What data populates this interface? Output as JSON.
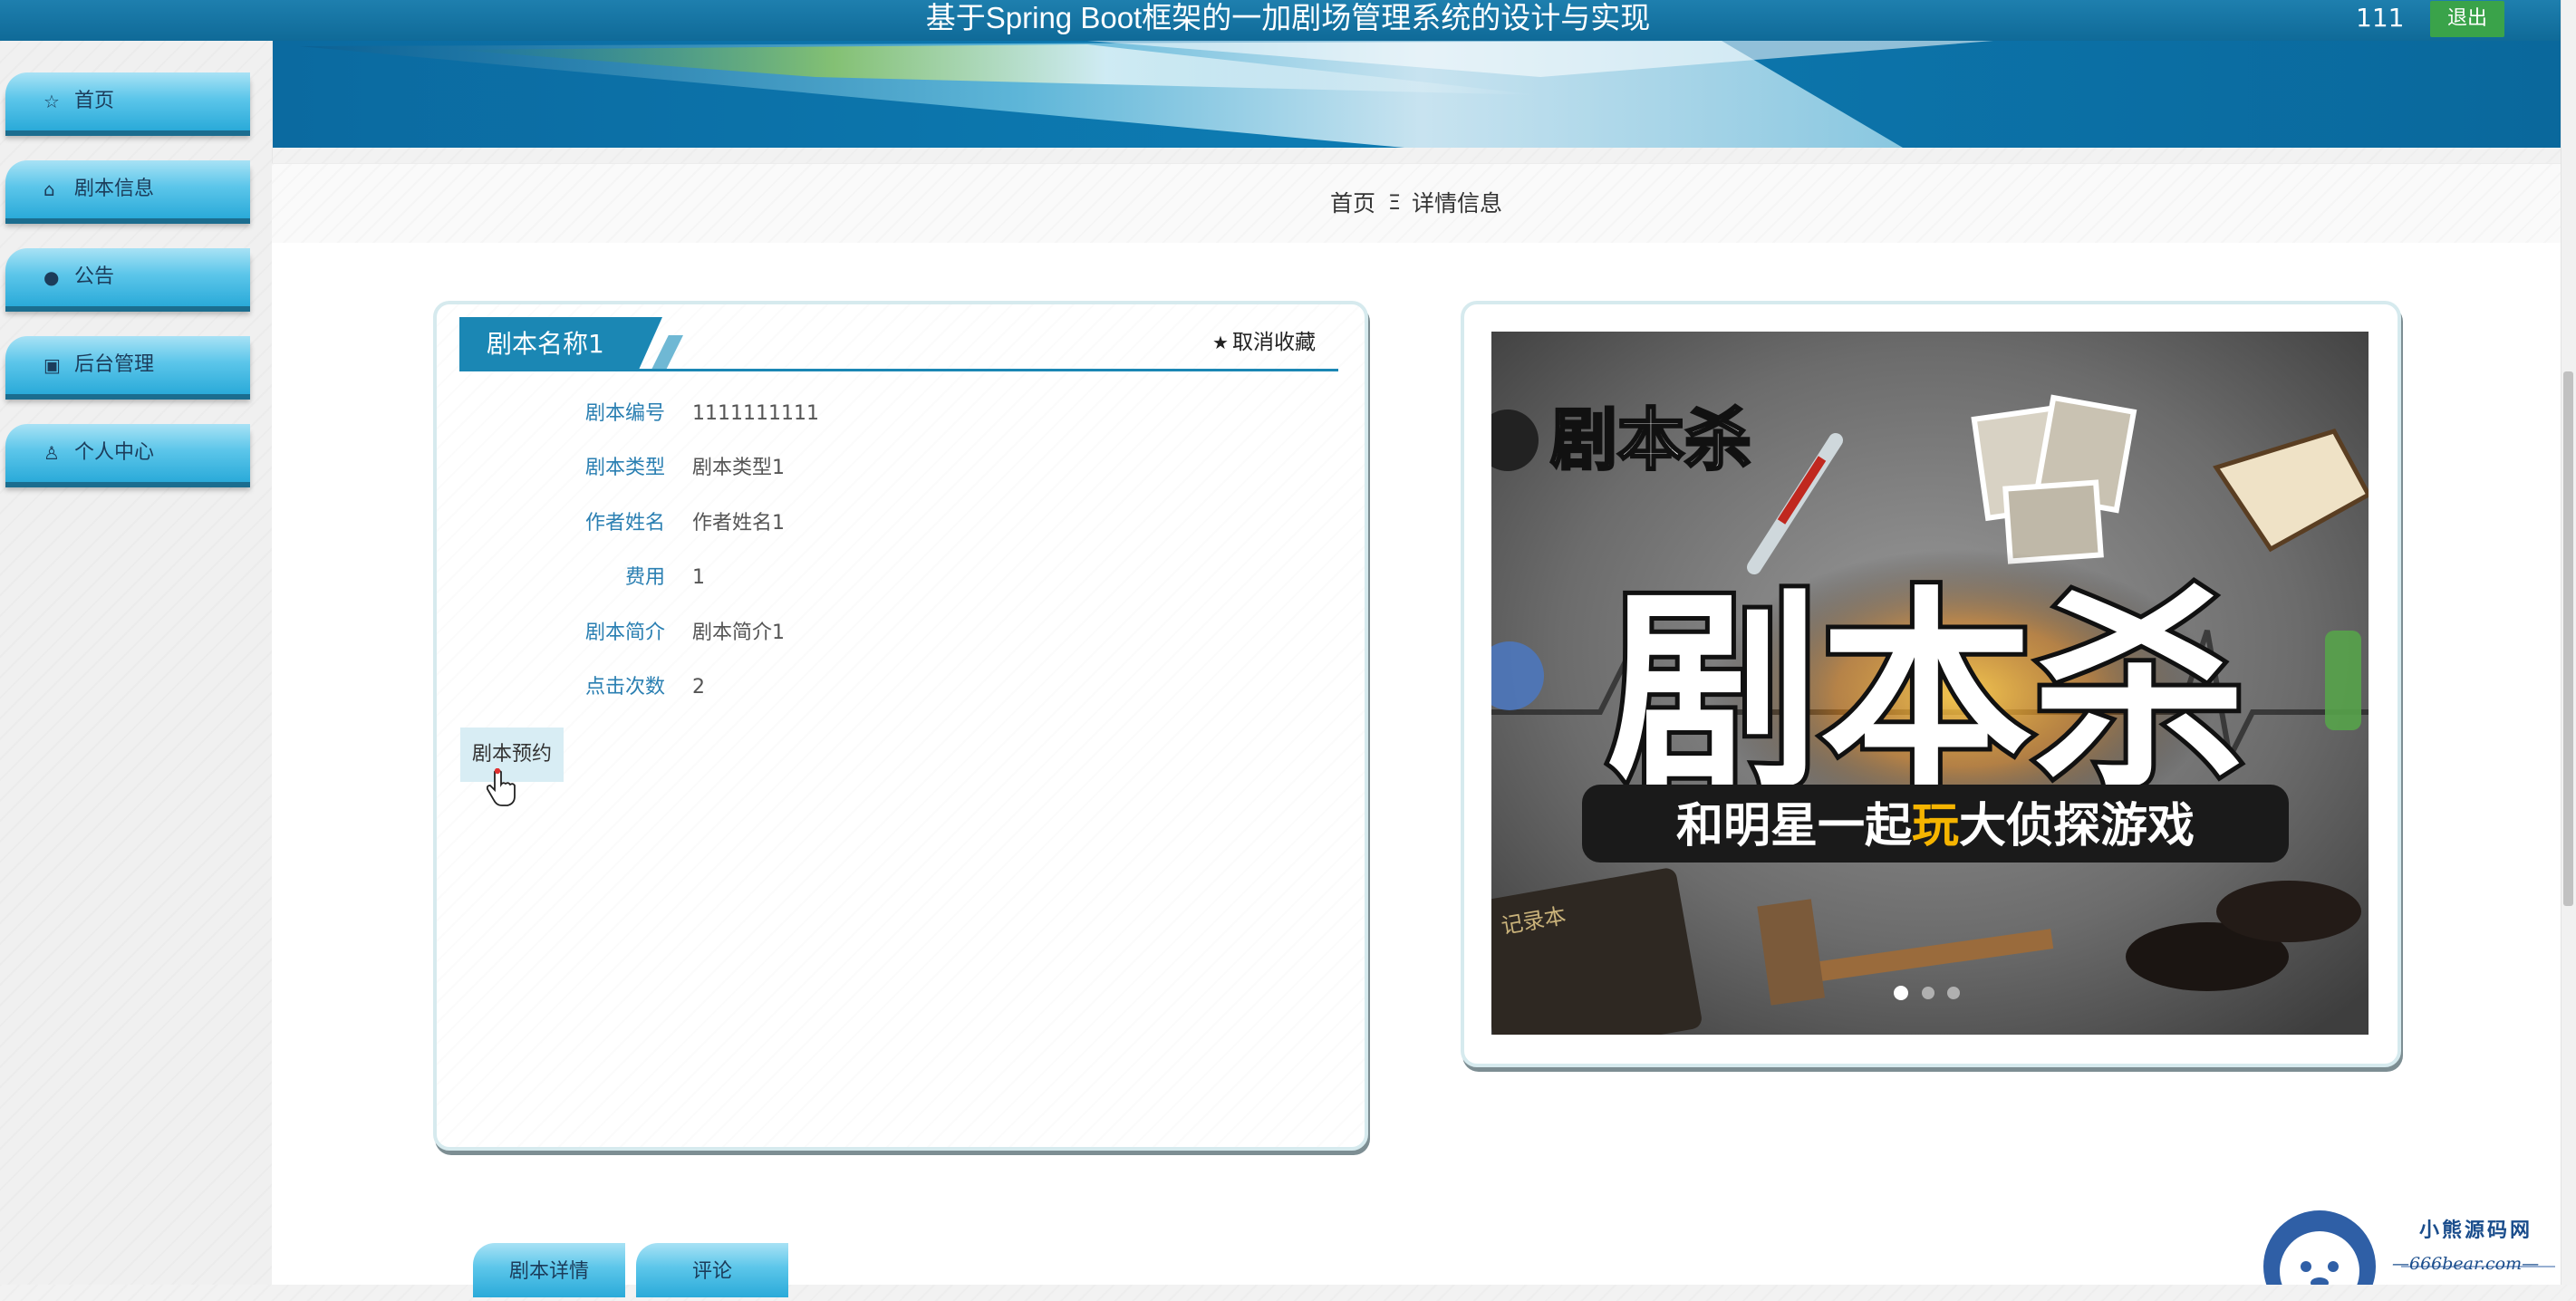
{
  "header": {
    "title": "基于Spring Boot框架的一加剧场管理系统的设计与实现",
    "username": "111",
    "logout_label": "退出"
  },
  "sidebar": {
    "items": [
      {
        "label": "首页",
        "icon": "star-outline-icon"
      },
      {
        "label": "剧本信息",
        "icon": "bag-icon"
      },
      {
        "label": "公告",
        "icon": "alert-circle-icon"
      },
      {
        "label": "后台管理",
        "icon": "briefcase-icon"
      },
      {
        "label": "个人中心",
        "icon": "user-icon"
      }
    ]
  },
  "breadcrumb": {
    "home": "首页",
    "separator": "Ξ",
    "current": "详情信息"
  },
  "detail": {
    "name": "剧本名称1",
    "favorite_label": "取消收藏",
    "fields": [
      {
        "label": "剧本编号",
        "value": "1111111111"
      },
      {
        "label": "剧本类型",
        "value": "剧本类型1"
      },
      {
        "label": "作者姓名",
        "value": "作者姓名1"
      },
      {
        "label": "费用",
        "value": "1"
      },
      {
        "label": "剧本简介",
        "value": "剧本简介1"
      },
      {
        "label": "点击次数",
        "value": "2"
      }
    ],
    "reserve_label": "剧本预约"
  },
  "poster": {
    "logo_text": "剧本杀",
    "headline": "剧本杀",
    "tagline_part1": "和明星一起",
    "tagline_highlight": "玩",
    "tagline_part2": "大侦探游戏",
    "book_text": "记录本",
    "slides": 3,
    "active_slide": 1
  },
  "bottom_tabs": [
    {
      "label": "剧本详情"
    },
    {
      "label": "评论"
    }
  ],
  "watermark": {
    "line1": "小熊源码网",
    "line2": "—666bear.com—"
  },
  "colors": {
    "header": "#1277a6",
    "accent": "#1b87b4",
    "label": "#2a7fb2",
    "logout": "#3aa34a",
    "tagline_highlight": "#f5b400"
  }
}
